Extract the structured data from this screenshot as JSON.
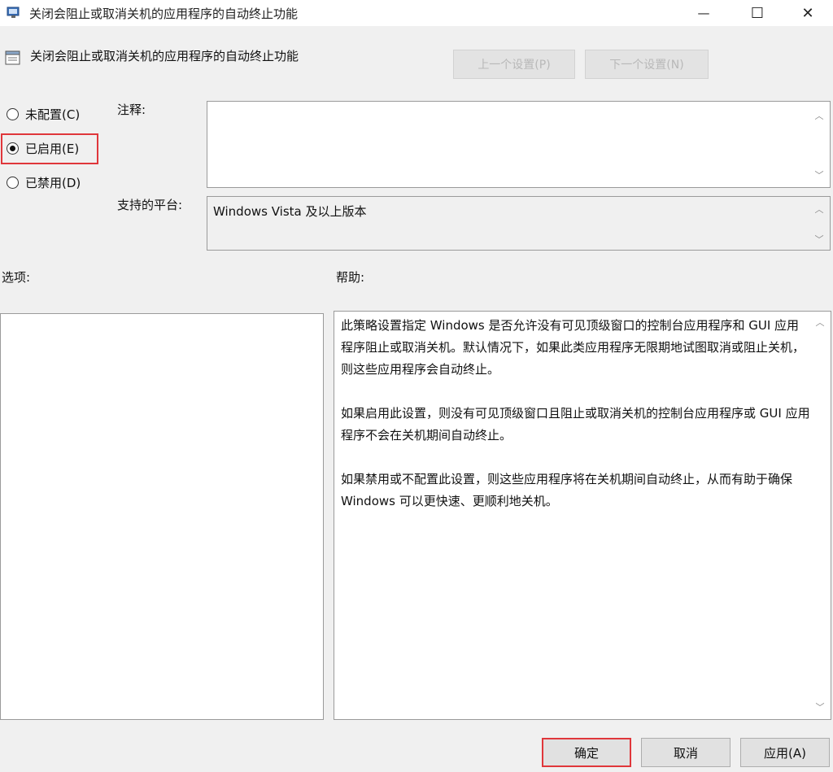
{
  "window": {
    "title": "关闭会阻止或取消关机的应用程序的自动终止功能",
    "minimize_glyph": "—",
    "maximize_glyph": "☐",
    "close_glyph": "✕",
    "icon": "policy-icon"
  },
  "header": {
    "setting_name": "关闭会阻止或取消关机的应用程序的自动终止功能",
    "prev_button": "上一个设置(P)",
    "next_button": "下一个设置(N)",
    "icon": "policy-setting-icon"
  },
  "state_options": [
    {
      "label": "未配置(C)",
      "checked": false
    },
    {
      "label": "已启用(E)",
      "checked": true
    },
    {
      "label": "已禁用(D)",
      "checked": false
    }
  ],
  "comment": {
    "label": "注释:",
    "value": ""
  },
  "platform": {
    "label": "支持的平台:",
    "value": "Windows Vista 及以上版本"
  },
  "options": {
    "label": "选项:"
  },
  "help": {
    "label": "帮助:",
    "paragraphs": [
      "此策略设置指定 Windows 是否允许没有可见顶级窗口的控制台应用程序和 GUI 应用程序阻止或取消关机。默认情况下，如果此类应用程序无限期地试图取消或阻止关机，则这些应用程序会自动终止。",
      "如果启用此设置，则没有可见顶级窗口且阻止或取消关机的控制台应用程序或 GUI 应用程序不会在关机期间自动终止。",
      "如果禁用或不配置此设置，则这些应用程序将在关机期间自动终止，从而有助于确保 Windows 可以更快速、更顺利地关机。"
    ]
  },
  "buttons": {
    "ok": "确定",
    "cancel": "取消",
    "apply": "应用(A)"
  },
  "colors": {
    "highlight": "#e0373b",
    "window_bg": "#f0f0f0"
  }
}
